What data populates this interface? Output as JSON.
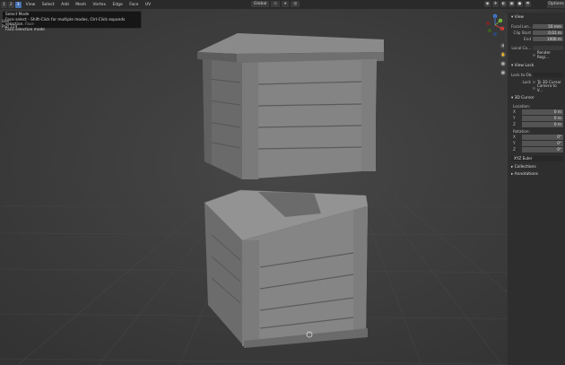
{
  "header": {
    "mode_buttons": [
      "1",
      "2",
      "3"
    ],
    "menus": [
      "View",
      "Select",
      "Add",
      "Mesh",
      "Vertex",
      "Edge",
      "Face",
      "UV"
    ],
    "transform_orientation": "Global",
    "options_label": "Options"
  },
  "tooltip": {
    "title": "Select Mode",
    "line2_main": "Face select - Shift-Click for multiple modes, Ctrl-Click expands selection.",
    "line2_dim": "Face",
    "line3": "Face selection mode"
  },
  "left_info": {
    "line1": "Use",
    "line2": "Pad 224"
  },
  "gizmo": {
    "x": "X",
    "y": "Y",
    "z": "Z",
    "color_x": "#e5403f",
    "color_y": "#7fc43a",
    "color_z": "#4a86e8"
  },
  "npanel": {
    "view_header": "View",
    "focal_label": "Focal Len...",
    "focal_value": "50 mm",
    "clip_start_label": "Clip Start",
    "clip_start_value": "0.01 m",
    "end_label": "End",
    "end_value": "1000 m",
    "local_camera_label": "Local Ca...",
    "render_region_label": "Render Regi...",
    "view_lock_header": "View Lock",
    "lock_to_label": "Lock to Ob...",
    "lock_label": "Lock",
    "to_3d_cursor_label": "To 3D Cursor",
    "camera_to_view_label": "Camera to V...",
    "cursor_header": "3D Cursor",
    "location_label": "Location:",
    "loc_x": "0 m",
    "loc_y": "0 m",
    "loc_z": "0 m",
    "rotation_label": "Rotation:",
    "rot_x": "0°",
    "rot_y": "0°",
    "rot_z": "0°",
    "rotation_mode": "XYZ Euler",
    "collections_header": "Collections",
    "annotations_header": "Annotations"
  }
}
